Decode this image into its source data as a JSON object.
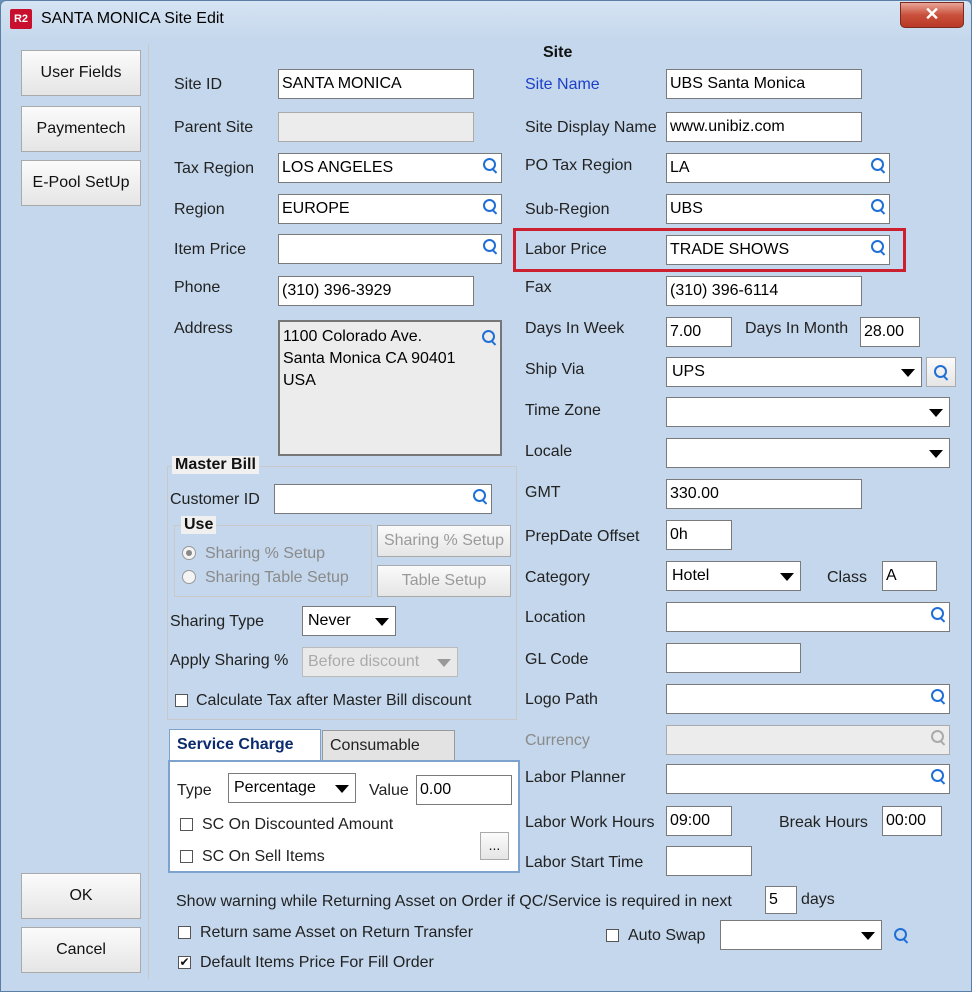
{
  "window": {
    "title": "SANTA MONICA Site Edit",
    "app_icon": "R2",
    "close": "✕"
  },
  "left_buttons": {
    "user_fields": "User Fields",
    "paymentech": "Paymentech",
    "epool": "E-Pool SetUp",
    "ok": "OK",
    "cancel": "Cancel"
  },
  "section_title": "Site",
  "left": {
    "site_id": {
      "label": "Site ID",
      "value": "SANTA MONICA"
    },
    "parent_site": {
      "label": "Parent Site",
      "value": ""
    },
    "tax_region": {
      "label": "Tax Region",
      "value": "LOS ANGELES"
    },
    "region": {
      "label": "Region",
      "value": "EUROPE"
    },
    "item_price": {
      "label": "Item Price",
      "value": ""
    },
    "phone": {
      "label": "Phone",
      "value": "(310) 396-3929"
    },
    "address": {
      "label": "Address",
      "line1": "1100 Colorado Ave.",
      "line2": "Santa Monica CA 90401",
      "line3": "USA"
    }
  },
  "master_bill": {
    "title": "Master Bill",
    "customer_id": {
      "label": "Customer ID",
      "value": ""
    },
    "use_title": "Use",
    "sharing_pct_setup": "Sharing % Setup",
    "sharing_table_setup": "Sharing Table Setup",
    "sharing_pct_btn": "Sharing % Setup",
    "table_setup_btn": "Table Setup",
    "sharing_type": {
      "label": "Sharing Type",
      "value": "Never"
    },
    "apply_sharing": {
      "label": "Apply Sharing %",
      "value": "Before discount"
    },
    "calc_tax": "Calculate Tax after Master Bill discount"
  },
  "tabs": {
    "service_charge": "Service Charge",
    "consumable": "Consumable"
  },
  "service": {
    "type_label": "Type",
    "type_value": "Percentage",
    "value_label": "Value",
    "value_value": "0.00",
    "sc_discounted": "SC On Discounted Amount",
    "sc_sell": "SC On Sell Items",
    "more_btn": "..."
  },
  "right": {
    "site_name": {
      "label": "Site Name",
      "value": "UBS Santa Monica"
    },
    "site_display": {
      "label": "Site Display Name",
      "value": "www.unibiz.com"
    },
    "po_tax_region": {
      "label": "PO Tax Region",
      "value": "LA"
    },
    "sub_region": {
      "label": "Sub-Region",
      "value": "UBS"
    },
    "labor_price": {
      "label": "Labor Price",
      "value": "TRADE SHOWS"
    },
    "fax": {
      "label": "Fax",
      "value": "(310) 396-6114"
    },
    "days_in_week": {
      "label": "Days In Week",
      "value": "7.00"
    },
    "days_in_month": {
      "label": "Days In Month",
      "value": "28.00"
    },
    "ship_via": {
      "label": "Ship Via",
      "value": "UPS"
    },
    "time_zone": {
      "label": "Time Zone",
      "value": ""
    },
    "locale": {
      "label": "Locale",
      "value": ""
    },
    "gmt": {
      "label": "GMT",
      "value": "330.00"
    },
    "prepdate": {
      "label": "PrepDate Offset",
      "value": "0h"
    },
    "category": {
      "label": "Category",
      "value": "Hotel"
    },
    "class": {
      "label": "Class",
      "value": "A"
    },
    "location": {
      "label": "Location",
      "value": ""
    },
    "gl_code": {
      "label": "GL Code",
      "value": ""
    },
    "logo_path": {
      "label": "Logo Path",
      "value": ""
    },
    "currency": {
      "label": "Currency",
      "value": ""
    },
    "labor_planner": {
      "label": "Labor Planner",
      "value": ""
    },
    "labor_work_hours": {
      "label": "Labor Work Hours",
      "value": "09:00"
    },
    "break_hours": {
      "label": "Break Hours",
      "value": "00:00"
    },
    "labor_start_time": {
      "label": "Labor Start Time",
      "value": ""
    }
  },
  "bottom": {
    "warning_text": "Show warning while Returning Asset on Order if QC/Service is required in next",
    "warning_days": "5",
    "days_label": "days",
    "return_same": "Return same Asset on Return Transfer",
    "default_items": "Default Items Price For Fill Order",
    "auto_swap": "Auto Swap",
    "auto_swap_value": "",
    "check_mark": "✔"
  }
}
